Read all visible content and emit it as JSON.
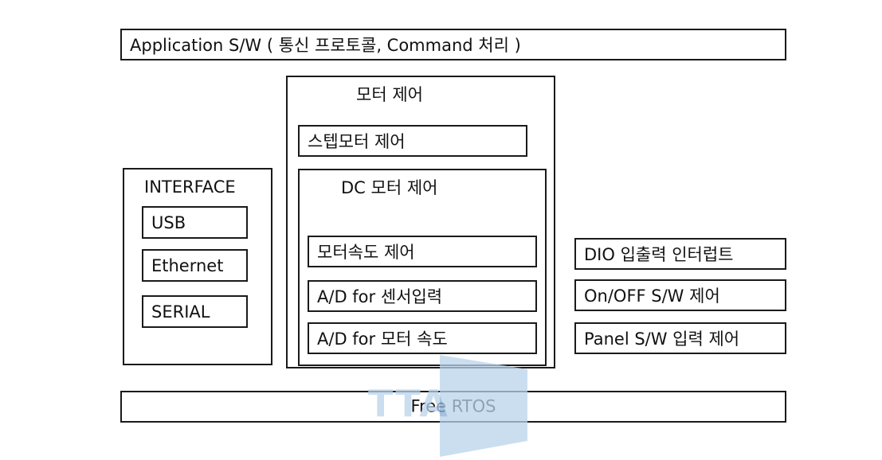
{
  "diagram": {
    "application_layer": "Application S/W ( 통신 프로토콜, Command 처리 )",
    "interface": {
      "title": "INTERFACE",
      "items": [
        "USB",
        "Ethernet",
        "SERIAL"
      ]
    },
    "motor_control": {
      "title": "모터 제어",
      "stepper": "스텝모터 제어",
      "dc_motor": {
        "title": "DC 모터 제어",
        "items": [
          "모터속도 제어",
          "A/D for 센서입력",
          "A/D for 모터 속도"
        ]
      }
    },
    "io_blocks": [
      "DIO 입출력 인터럽트",
      "On/OFF S/W 제어",
      "Panel S/W 입력 제어"
    ],
    "rtos_layer": "Free RTOS"
  },
  "watermark": {
    "text": "TTA",
    "color": "#b9d3ea"
  }
}
